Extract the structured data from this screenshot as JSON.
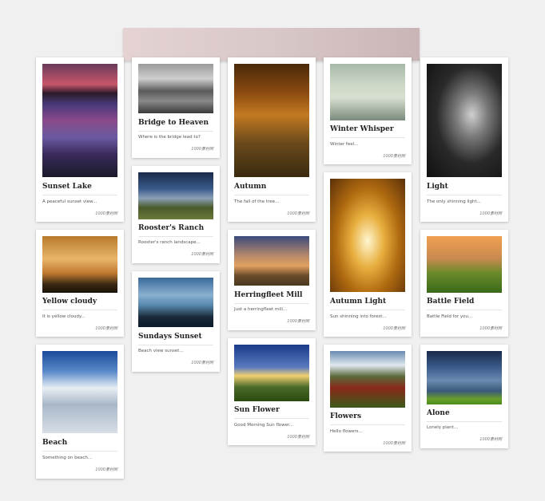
{
  "cards": [
    {
      "title": "Sunset Lake",
      "desc": "A peaceful sunset view...",
      "source": "1000素材网"
    },
    {
      "title": "Yellow cloudy",
      "desc": "It is yellow cloudy...",
      "source": "1000素材网"
    },
    {
      "title": "Beach",
      "desc": "Something on beach...",
      "source": "1000素材网"
    },
    {
      "title": "Bridge to Heaven",
      "desc": "Where is the bridge lead to?",
      "source": "1000素材网"
    },
    {
      "title": "Rooster's Ranch",
      "desc": "Rooster's ranch landscape...",
      "source": "1000素材网"
    },
    {
      "title": "Sundays Sunset",
      "desc": "Beach view sunset...",
      "source": "1000素材网"
    },
    {
      "title": "Autumn",
      "desc": "The fall of the tree...",
      "source": "1000素材网"
    },
    {
      "title": "Herringfleet Mill",
      "desc": "Just a herringfleet mill...",
      "source": "1000素材网"
    },
    {
      "title": "Sun Flower",
      "desc": "Good Morning Sun flower...",
      "source": "1000素材网"
    },
    {
      "title": "Winter Whisper",
      "desc": "Winter feel...",
      "source": "1000素材网"
    },
    {
      "title": "Autumn Light",
      "desc": "Sun shinning into forest...",
      "source": "1000素材网"
    },
    {
      "title": "Flowers",
      "desc": "Hello flowers...",
      "source": "1000素材网"
    },
    {
      "title": "Light",
      "desc": "The only shinning light...",
      "source": "1000素材网"
    },
    {
      "title": "Battle Field",
      "desc": "Battle Field for you...",
      "source": "1000素材网"
    },
    {
      "title": "Alone",
      "desc": "Lonely plant...",
      "source": "1000素材网"
    }
  ]
}
